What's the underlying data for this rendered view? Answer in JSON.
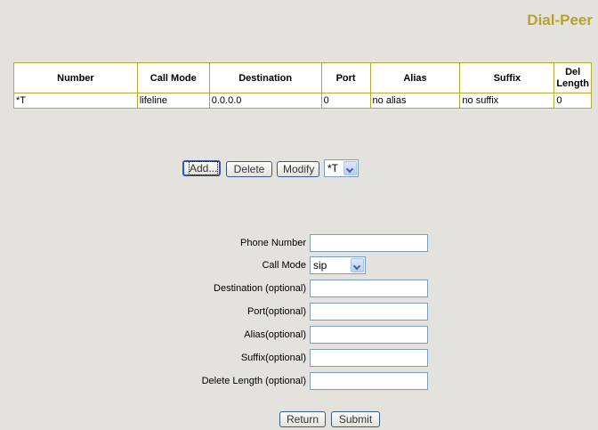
{
  "page": {
    "title": "Dial-Peer"
  },
  "table": {
    "headers": [
      "Number",
      "Call Mode",
      "Destination",
      "Port",
      "Alias",
      "Suffix",
      "Del\nLength"
    ],
    "rows": [
      [
        "*T",
        "lifeline",
        "0.0.0.0",
        "0",
        "no alias",
        "no suffix",
        "0"
      ]
    ]
  },
  "actions": {
    "add_label": "Add...",
    "delete_label": "Delete",
    "modify_label": "Modify",
    "peer_select_value": "*T"
  },
  "form": {
    "phone_number_label": "Phone Number",
    "phone_number_value": "",
    "call_mode_label": "Call Mode",
    "call_mode_value": "sip",
    "destination_label": "Destination (optional)",
    "destination_value": "",
    "port_label": "Port(optional)",
    "port_value": "",
    "alias_label": "Alias(optional)",
    "alias_value": "",
    "suffix_label": "Suffix(optional)",
    "suffix_value": "",
    "delete_length_label": "Delete Length (optional)",
    "delete_length_value": ""
  },
  "footer": {
    "return_label": "Return",
    "submit_label": "Submit"
  },
  "colors": {
    "title": "#b7a32a",
    "table_border": "#b8a83a",
    "background": "#e4e2dc"
  }
}
